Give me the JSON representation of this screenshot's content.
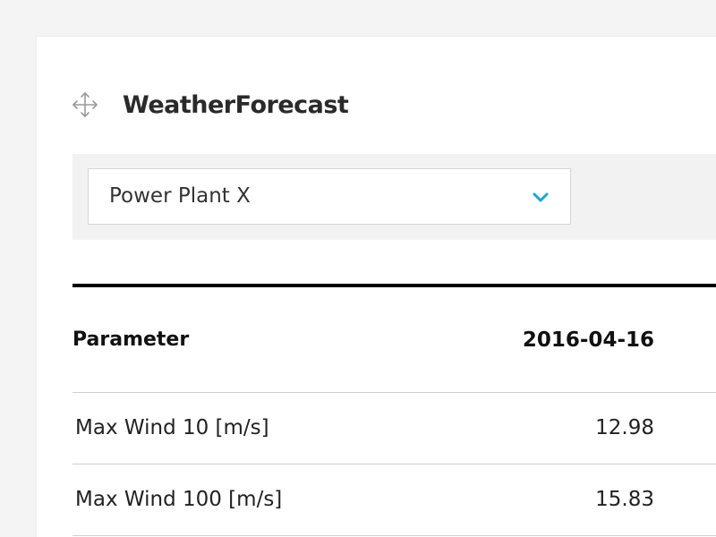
{
  "widget": {
    "title": "WeatherForecast",
    "move_icon": "move-arrows-icon"
  },
  "filter": {
    "selected_plant": "Power Plant X",
    "chevron_icon": "chevron-down-icon",
    "accent_color": "#1aa6d8"
  },
  "table": {
    "headers": {
      "parameter": "Parameter",
      "date": "2016-04-16"
    },
    "rows": [
      {
        "parameter": "Max Wind 10 [m/s]",
        "value": "12.98"
      },
      {
        "parameter": "Max Wind 100 [m/s]",
        "value": "15.83"
      }
    ]
  }
}
